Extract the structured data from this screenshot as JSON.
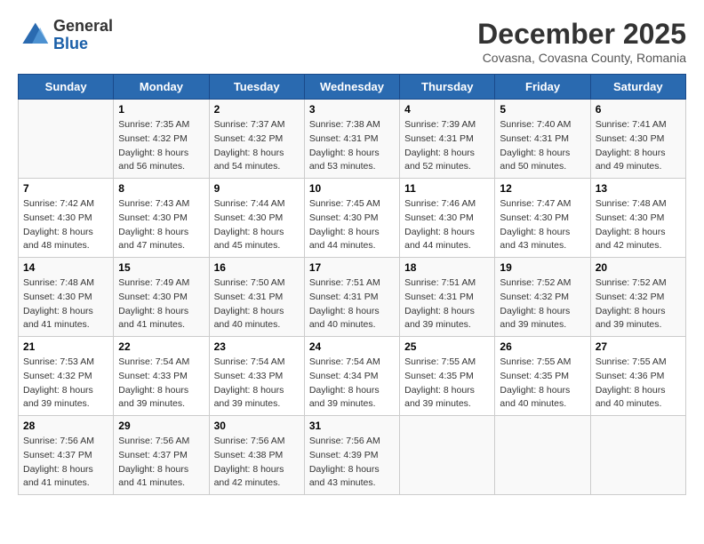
{
  "header": {
    "logo": {
      "line1": "General",
      "line2": "Blue"
    },
    "title": "December 2025",
    "subtitle": "Covasna, Covasna County, Romania"
  },
  "days_of_week": [
    "Sunday",
    "Monday",
    "Tuesday",
    "Wednesday",
    "Thursday",
    "Friday",
    "Saturday"
  ],
  "weeks": [
    [
      {
        "day": "",
        "info": ""
      },
      {
        "day": "1",
        "info": "Sunrise: 7:35 AM\nSunset: 4:32 PM\nDaylight: 8 hours\nand 56 minutes."
      },
      {
        "day": "2",
        "info": "Sunrise: 7:37 AM\nSunset: 4:32 PM\nDaylight: 8 hours\nand 54 minutes."
      },
      {
        "day": "3",
        "info": "Sunrise: 7:38 AM\nSunset: 4:31 PM\nDaylight: 8 hours\nand 53 minutes."
      },
      {
        "day": "4",
        "info": "Sunrise: 7:39 AM\nSunset: 4:31 PM\nDaylight: 8 hours\nand 52 minutes."
      },
      {
        "day": "5",
        "info": "Sunrise: 7:40 AM\nSunset: 4:31 PM\nDaylight: 8 hours\nand 50 minutes."
      },
      {
        "day": "6",
        "info": "Sunrise: 7:41 AM\nSunset: 4:30 PM\nDaylight: 8 hours\nand 49 minutes."
      }
    ],
    [
      {
        "day": "7",
        "info": "Sunrise: 7:42 AM\nSunset: 4:30 PM\nDaylight: 8 hours\nand 48 minutes."
      },
      {
        "day": "8",
        "info": "Sunrise: 7:43 AM\nSunset: 4:30 PM\nDaylight: 8 hours\nand 47 minutes."
      },
      {
        "day": "9",
        "info": "Sunrise: 7:44 AM\nSunset: 4:30 PM\nDaylight: 8 hours\nand 45 minutes."
      },
      {
        "day": "10",
        "info": "Sunrise: 7:45 AM\nSunset: 4:30 PM\nDaylight: 8 hours\nand 44 minutes."
      },
      {
        "day": "11",
        "info": "Sunrise: 7:46 AM\nSunset: 4:30 PM\nDaylight: 8 hours\nand 44 minutes."
      },
      {
        "day": "12",
        "info": "Sunrise: 7:47 AM\nSunset: 4:30 PM\nDaylight: 8 hours\nand 43 minutes."
      },
      {
        "day": "13",
        "info": "Sunrise: 7:48 AM\nSunset: 4:30 PM\nDaylight: 8 hours\nand 42 minutes."
      }
    ],
    [
      {
        "day": "14",
        "info": "Sunrise: 7:48 AM\nSunset: 4:30 PM\nDaylight: 8 hours\nand 41 minutes."
      },
      {
        "day": "15",
        "info": "Sunrise: 7:49 AM\nSunset: 4:30 PM\nDaylight: 8 hours\nand 41 minutes."
      },
      {
        "day": "16",
        "info": "Sunrise: 7:50 AM\nSunset: 4:31 PM\nDaylight: 8 hours\nand 40 minutes."
      },
      {
        "day": "17",
        "info": "Sunrise: 7:51 AM\nSunset: 4:31 PM\nDaylight: 8 hours\nand 40 minutes."
      },
      {
        "day": "18",
        "info": "Sunrise: 7:51 AM\nSunset: 4:31 PM\nDaylight: 8 hours\nand 39 minutes."
      },
      {
        "day": "19",
        "info": "Sunrise: 7:52 AM\nSunset: 4:32 PM\nDaylight: 8 hours\nand 39 minutes."
      },
      {
        "day": "20",
        "info": "Sunrise: 7:52 AM\nSunset: 4:32 PM\nDaylight: 8 hours\nand 39 minutes."
      }
    ],
    [
      {
        "day": "21",
        "info": "Sunrise: 7:53 AM\nSunset: 4:32 PM\nDaylight: 8 hours\nand 39 minutes."
      },
      {
        "day": "22",
        "info": "Sunrise: 7:54 AM\nSunset: 4:33 PM\nDaylight: 8 hours\nand 39 minutes."
      },
      {
        "day": "23",
        "info": "Sunrise: 7:54 AM\nSunset: 4:33 PM\nDaylight: 8 hours\nand 39 minutes."
      },
      {
        "day": "24",
        "info": "Sunrise: 7:54 AM\nSunset: 4:34 PM\nDaylight: 8 hours\nand 39 minutes."
      },
      {
        "day": "25",
        "info": "Sunrise: 7:55 AM\nSunset: 4:35 PM\nDaylight: 8 hours\nand 39 minutes."
      },
      {
        "day": "26",
        "info": "Sunrise: 7:55 AM\nSunset: 4:35 PM\nDaylight: 8 hours\nand 40 minutes."
      },
      {
        "day": "27",
        "info": "Sunrise: 7:55 AM\nSunset: 4:36 PM\nDaylight: 8 hours\nand 40 minutes."
      }
    ],
    [
      {
        "day": "28",
        "info": "Sunrise: 7:56 AM\nSunset: 4:37 PM\nDaylight: 8 hours\nand 41 minutes."
      },
      {
        "day": "29",
        "info": "Sunrise: 7:56 AM\nSunset: 4:37 PM\nDaylight: 8 hours\nand 41 minutes."
      },
      {
        "day": "30",
        "info": "Sunrise: 7:56 AM\nSunset: 4:38 PM\nDaylight: 8 hours\nand 42 minutes."
      },
      {
        "day": "31",
        "info": "Sunrise: 7:56 AM\nSunset: 4:39 PM\nDaylight: 8 hours\nand 43 minutes."
      },
      {
        "day": "",
        "info": ""
      },
      {
        "day": "",
        "info": ""
      },
      {
        "day": "",
        "info": ""
      }
    ]
  ]
}
